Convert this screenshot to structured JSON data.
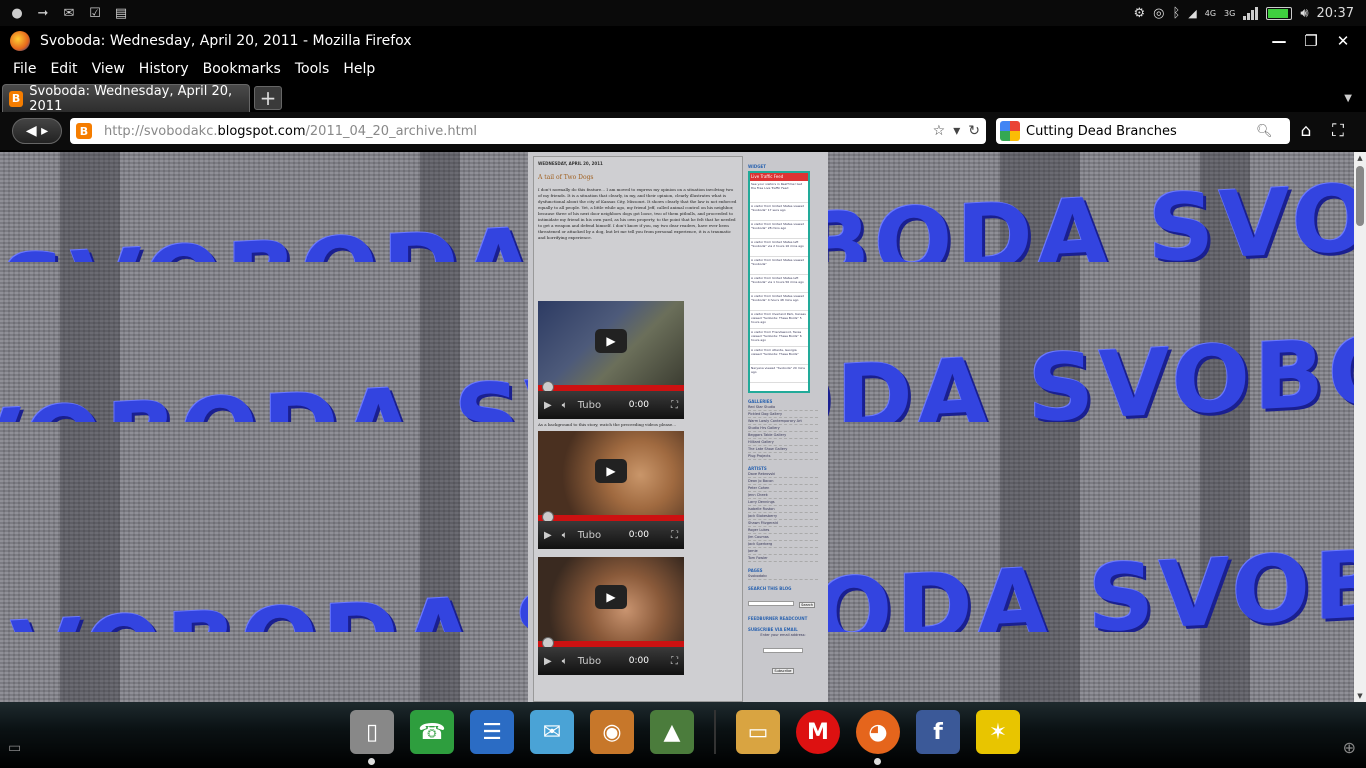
{
  "statusbar": {
    "time": "20:37",
    "network_label": "3G",
    "network_label2": "4G",
    "battery_level": 0.9,
    "icons": [
      "camera-icon",
      "usb-icon",
      "mail-icon",
      "clipboard-icon",
      "sd-card-icon"
    ]
  },
  "window": {
    "title": "Svoboda: Wednesday, April 20, 2011 - Mozilla Firefox"
  },
  "menu": {
    "items": [
      "File",
      "Edit",
      "View",
      "History",
      "Bookmarks",
      "Tools",
      "Help"
    ]
  },
  "tabs": [
    {
      "label": "Svoboda: Wednesday, April 20, 2011"
    }
  ],
  "navbar": {
    "url_prefix": "http://svobodakc.",
    "url_domain": "blogspot.com",
    "url_path": "/2011_04_20_archive.html",
    "search_value": "Cutting Dead Branches"
  },
  "page": {
    "background_word": "SVOBODA SVOBODA SVOBODA SVOBODA SVOBODA",
    "post": {
      "date": "WEDNESDAY, APRIL 20, 2011",
      "title": "A tail of Two Dogs",
      "body": "I don't normally do this feature... I am moved to express my opinion on a situation involving two of my friends. It is a situation that clearly, in my, and their opinion, clearly illustrates what is dysfunctional about the city of Kansas City, Missouri. It shows clearly that the law is not enforced equally to all people. Yet, a little while ago, my friend Jeff, called animal control on his neighbor, because three of his next door neighbors dogs got loose, two of them pitbulls, and proceeded to intimidate my friend in his own yard, as his own property, to the point that he felt that he needed to get a weapon and defend himself. I don't know if you, my two dear readers, have ever been threatened or attacked by a dog, but let me tell you from personal experience, it is a traumatic and horrifying experience.",
      "caption": "As a background to this story, watch the preceeding videos please..."
    },
    "videos": [
      {
        "time": "0:00",
        "tubo": "Tubo"
      },
      {
        "time": "0:00",
        "tubo": "Tubo"
      },
      {
        "time": "0:00",
        "tubo": "Tubo"
      }
    ],
    "sidebar": {
      "heading1": "WIDGET",
      "feed_title": "Live Traffic Feed",
      "feed_subtitle": "See your visitors in RealTime! Get the Free Live Traffic Feed",
      "feed_rows": [
        "A visitor from United States viewed \"Svoboda\" 17 secs ago",
        "A visitor from United States viewed \"Svoboda\" 28 mins ago",
        "A visitor from United States left \"Svoboda\" via 2 hours 16 mins ago",
        "A visitor from United States viewed \"Svoboda\"",
        "A visitor from United States left \"Svoboda\" via 1 hours 56 mins ago",
        "A visitor from United States viewed \"Svoboda\" 4 hours 48 mins ago",
        "A visitor from Overland Park, Kansas viewed \"Svoboda: These Boots\" 5 hours ago",
        "A visitor from Friendswood, Texas viewed \"Svoboda: These Boots\" 6 hours ago",
        "A visitor from Atlanta, Georgia viewed \"Svoboda: These Boots\"",
        "Naryana viewed \"Svoboda\" 20 mins ago"
      ],
      "heading2": "GALLERIES",
      "galleries": [
        "Red Star Studio",
        "Pickled Dog Gallery",
        "Warm Lowly Contemporary Art",
        "Studio Hrs Gallery",
        "Beggars Table Gallery",
        "Hilliard Gallery",
        "The Late Show Gallery",
        "Plug Projects"
      ],
      "heading3": "ARTISTS",
      "artists": [
        "Dave Rebrovski",
        "Dean Jo Bacon",
        "Peter Cohen",
        "Jenn Cheek",
        "Larry Dennings",
        "Isabelle Ruston",
        "Jack Stokesberry",
        "Shawn Fitzgerald",
        "Roger Lukes",
        "Jim Coumas",
        "Jack Sperberg",
        "Jamie",
        "Tom Fowler"
      ],
      "heading4": "PAGES",
      "pages": [
        "Svobodakc"
      ],
      "heading5": "SEARCH THIS BLOG",
      "search_button": "Search",
      "heading6": "FEEDBURNER READCOUNT",
      "heading7": "SUBSCRIBE VIA EMAIL",
      "email_label": "Enter your email address:",
      "subscribe_button": "Subscribe"
    }
  },
  "dock": {
    "apps": [
      {
        "name": "phone-app-icon",
        "color": "#888"
      },
      {
        "name": "dialer-icon",
        "color": "#2e9e3e"
      },
      {
        "name": "contacts-icon",
        "color": "#2b6cc4"
      },
      {
        "name": "email-icon",
        "color": "#4aa3d6"
      },
      {
        "name": "music-icon",
        "color": "#c7772a"
      },
      {
        "name": "gallery-icon",
        "color": "#4b7c3c"
      },
      {
        "name": "files-icon",
        "color": "#d9a441"
      },
      {
        "name": "motorola-icon",
        "color": "#d11"
      },
      {
        "name": "firefox-icon",
        "color": "#e5651c"
      },
      {
        "name": "facebook-icon",
        "color": "#3b5998"
      },
      {
        "name": "sprint-icon",
        "color": "#e8c500"
      }
    ],
    "facebook_glyph": "f"
  }
}
